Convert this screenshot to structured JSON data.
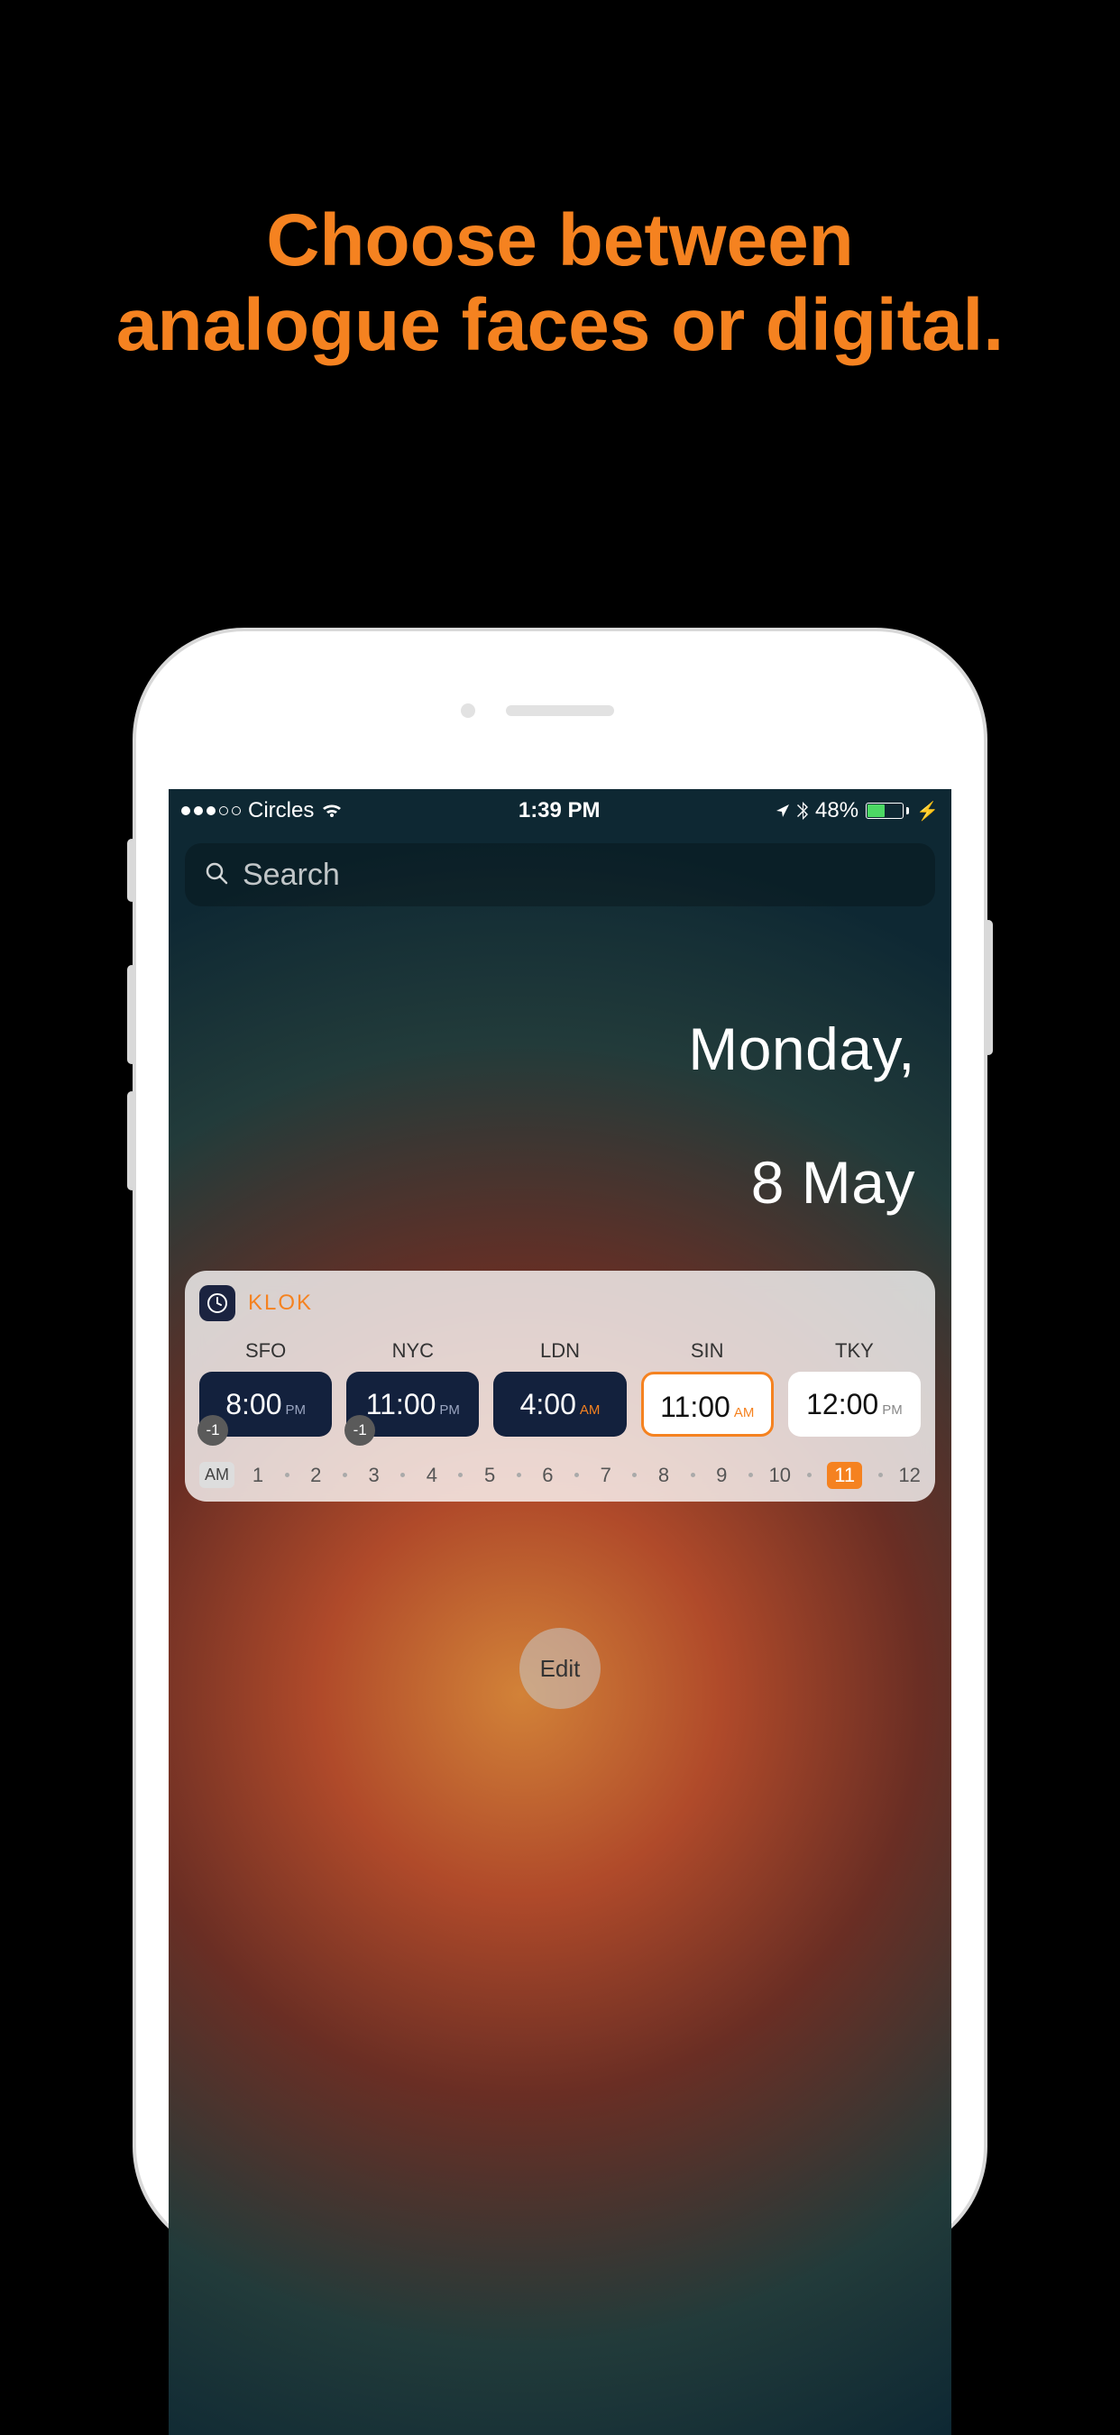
{
  "headline": "Choose between\nanalogue faces or digital.",
  "status": {
    "carrier": "Circles",
    "time": "1:39 PM",
    "battery_pct": "48%"
  },
  "search": {
    "placeholder": "Search"
  },
  "date": {
    "weekday": "Monday,",
    "day": "8 May"
  },
  "widget": {
    "app_name": "KLOK",
    "clocks": [
      {
        "code": "SFO",
        "time": "8:00",
        "ampm": "PM",
        "style": "dark",
        "offset": "-1"
      },
      {
        "code": "NYC",
        "time": "11:00",
        "ampm": "PM",
        "style": "dark",
        "offset": "-1"
      },
      {
        "code": "LDN",
        "time": "4:00",
        "ampm": "AM",
        "style": "dark",
        "offset": null
      },
      {
        "code": "SIN",
        "time": "11:00",
        "ampm": "AM",
        "style": "highlight",
        "offset": null
      },
      {
        "code": "TKY",
        "time": "12:00",
        "ampm": "PM",
        "style": "light",
        "offset": null
      }
    ],
    "ruler": {
      "mode": "AM",
      "hours": [
        "1",
        "2",
        "3",
        "4",
        "5",
        "6",
        "7",
        "8",
        "9",
        "10",
        "11",
        "12"
      ],
      "current": "11"
    }
  },
  "edit_label": "Edit"
}
